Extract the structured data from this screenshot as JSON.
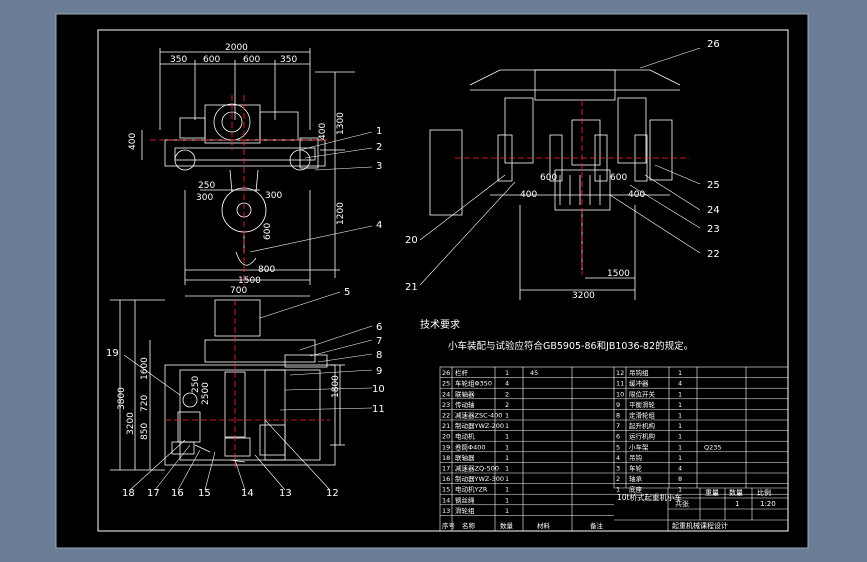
{
  "colors": {
    "frame_bg": "#6b7d94",
    "sheet": "#000000",
    "line": "#ffffff",
    "centerline": "#ff2a2a",
    "hatch": "#bfbfbf"
  },
  "front_view": {
    "dims_top": [
      "2000",
      "350",
      "600",
      "600",
      "350"
    ],
    "dims_left": [
      "400"
    ],
    "dims_right": [
      "1300",
      "400",
      "1200"
    ],
    "dims_bottom": [
      "250",
      "300",
      "300",
      "600",
      "800",
      "1500"
    ]
  },
  "side_view": {
    "dims": [
      "600",
      "600",
      "400",
      "400",
      "1500",
      "3200"
    ]
  },
  "plan_view": {
    "dims_top": [
      "700"
    ],
    "dims_left": [
      "3800",
      "3200",
      "850",
      "720",
      "1600",
      "250",
      "2500"
    ],
    "dims_right": [
      "1800"
    ]
  },
  "callouts": [
    "26",
    "1",
    "2",
    "3",
    "4",
    "25",
    "24",
    "23",
    "22",
    "20",
    "21",
    "5",
    "6",
    "7",
    "8",
    "9",
    "10",
    "11",
    "19",
    "18",
    "17",
    "16",
    "15",
    "14",
    "13",
    "12"
  ],
  "notes": {
    "heading": "技术要求",
    "line1": "小车装配与试验应符合GB5905-86和JB1036-82的规定。"
  },
  "bom": {
    "title_block": {
      "name": "10t桥式起重机小车",
      "scale_label": "比例",
      "scale": "1:20",
      "weight_label": "重量",
      "qty_label": "数量",
      "sheet_label": "共张",
      "sheet_no": "1",
      "org": "起重机械课程设计"
    },
    "left_cols": [
      "序号",
      "名称",
      "数量",
      "材料",
      "备注"
    ],
    "left_rows": [
      [
        "26",
        "栏杆",
        "1",
        "45",
        ""
      ],
      [
        "25",
        "车轮组Φ350",
        "4",
        "",
        ""
      ],
      [
        "24",
        "联轴器",
        "2",
        "",
        ""
      ],
      [
        "23",
        "传动轴",
        "2",
        "",
        ""
      ],
      [
        "22",
        "减速器ZSC-400",
        "1",
        "",
        ""
      ],
      [
        "21",
        "制动器YWZ-200",
        "1",
        "",
        ""
      ],
      [
        "20",
        "电动机",
        "1",
        "",
        ""
      ],
      [
        "19",
        "卷筒Φ400",
        "1",
        "",
        ""
      ],
      [
        "18",
        "联轴器",
        "1",
        "",
        ""
      ],
      [
        "17",
        "减速器ZQ-500",
        "1",
        "",
        ""
      ],
      [
        "16",
        "制动器YWZ-300",
        "1",
        "",
        ""
      ],
      [
        "15",
        "电动机YZR",
        "1",
        "",
        ""
      ],
      [
        "14",
        "钢丝绳",
        "1",
        "",
        ""
      ],
      [
        "13",
        "滑轮组",
        "1",
        "",
        ""
      ]
    ],
    "right_rows": [
      [
        "12",
        "吊钩组",
        "1",
        "",
        ""
      ],
      [
        "11",
        "缓冲器",
        "4",
        "",
        ""
      ],
      [
        "10",
        "限位开关",
        "1",
        "",
        ""
      ],
      [
        "9",
        "平衡滑轮",
        "1",
        "",
        ""
      ],
      [
        "8",
        "定滑轮组",
        "1",
        "",
        ""
      ],
      [
        "7",
        "起升机构",
        "1",
        "",
        ""
      ],
      [
        "6",
        "运行机构",
        "1",
        "",
        ""
      ],
      [
        "5",
        "小车架",
        "1",
        "Q235",
        ""
      ],
      [
        "4",
        "吊钩",
        "1",
        "",
        ""
      ],
      [
        "3",
        "车轮",
        "4",
        "",
        ""
      ],
      [
        "2",
        "轴承",
        "8",
        "",
        ""
      ],
      [
        "1",
        "底座",
        "1",
        "",
        ""
      ]
    ]
  }
}
